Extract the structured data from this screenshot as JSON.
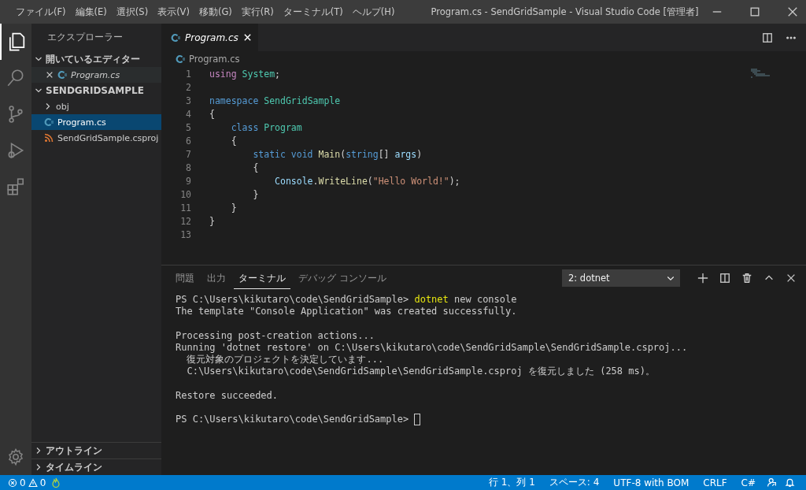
{
  "window": {
    "title": "Program.cs - SendGridSample - Visual Studio Code [管理者]"
  },
  "menu": [
    "ファイル(F)",
    "編集(E)",
    "選択(S)",
    "表示(V)",
    "移動(G)",
    "実行(R)",
    "ターミナル(T)",
    "ヘルプ(H)"
  ],
  "activity_bar": [
    {
      "kind": "explorer",
      "selected": true
    },
    {
      "kind": "search",
      "selected": false
    },
    {
      "kind": "scm",
      "selected": false
    },
    {
      "kind": "debug",
      "selected": false
    },
    {
      "kind": "extensions",
      "selected": false
    }
  ],
  "sidebar": {
    "title": "エクスプローラー",
    "open_editors": {
      "label": "開いているエディター",
      "expanded": true,
      "items": [
        {
          "name": "Program.cs",
          "kind": "csharp",
          "selected": false
        }
      ]
    },
    "folder": {
      "label": "SENDGRIDSAMPLE",
      "expanded": true,
      "items": [
        {
          "name": "obj",
          "kind": "folder",
          "selected": false
        },
        {
          "name": "Program.cs",
          "kind": "csharp",
          "selected": true
        },
        {
          "name": "SendGridSample.csproj",
          "kind": "rss",
          "selected": false
        }
      ]
    },
    "bottom_sections": [
      {
        "label": "アウトライン",
        "expanded": false
      },
      {
        "label": "タイムライン",
        "expanded": false
      }
    ]
  },
  "editor": {
    "tabs": [
      {
        "label": "Program.cs",
        "selected": true
      }
    ],
    "breadcrumb": "Program.cs",
    "lines": [
      {
        "number": "1",
        "tokens": [
          {
            "text": "using ",
            "kind": "control"
          },
          {
            "text": "System",
            "kind": "type"
          },
          {
            "text": ";",
            "kind": "plain"
          }
        ]
      },
      {
        "number": "2"
      },
      {
        "number": "3",
        "tokens": [
          {
            "text": "namespace ",
            "kind": "keyword"
          },
          {
            "text": "SendGridSample",
            "kind": "type"
          }
        ]
      },
      {
        "number": "4",
        "tokens": [
          {
            "text": "{",
            "kind": "plain"
          }
        ]
      },
      {
        "number": "5",
        "tokens": [
          {
            "text": "    class ",
            "kind": "keyword"
          },
          {
            "text": "Program",
            "kind": "type"
          }
        ]
      },
      {
        "number": "6",
        "tokens": [
          {
            "text": "    {",
            "kind": "plain"
          }
        ]
      },
      {
        "number": "7",
        "tokens": [
          {
            "text": "        static void ",
            "kind": "keyword"
          },
          {
            "text": "Main",
            "kind": "method"
          },
          {
            "text": "(",
            "kind": "plain"
          },
          {
            "text": "string",
            "kind": "keyword"
          },
          {
            "text": "[] ",
            "kind": "plain"
          },
          {
            "text": "args",
            "kind": "variable"
          },
          {
            "text": ")",
            "kind": "plain"
          }
        ]
      },
      {
        "number": "8",
        "tokens": [
          {
            "text": "        {",
            "kind": "plain"
          }
        ]
      },
      {
        "number": "9",
        "tokens": [
          {
            "text": "            Console",
            "kind": "variable"
          },
          {
            "text": ".",
            "kind": "plain"
          },
          {
            "text": "WriteLine",
            "kind": "method"
          },
          {
            "text": "(",
            "kind": "plain"
          },
          {
            "text": "\"Hello World!\"",
            "kind": "string"
          },
          {
            "text": ");",
            "kind": "plain"
          }
        ]
      },
      {
        "number": "10",
        "tokens": [
          {
            "text": "        }",
            "kind": "plain"
          }
        ]
      },
      {
        "number": "11",
        "tokens": [
          {
            "text": "    }",
            "kind": "plain"
          }
        ]
      },
      {
        "number": "12",
        "tokens": [
          {
            "text": "}",
            "kind": "plain"
          }
        ]
      },
      {
        "number": "13"
      }
    ]
  },
  "panel": {
    "tabs": [
      {
        "label": "問題",
        "selected": false
      },
      {
        "label": "出力",
        "selected": false
      },
      {
        "label": "ターミナル",
        "selected": true
      },
      {
        "label": "デバッグ コンソール",
        "selected": false
      }
    ],
    "terminal_select": "2: dotnet",
    "lines": [
      {
        "gap_before": false,
        "segments": [
          {
            "text": "PS C:\\Users\\kikutaro\\code\\SendGridSample> ",
            "kind": "plain"
          },
          {
            "text": "dotnet",
            "kind": "command"
          },
          {
            "text": " new console",
            "kind": "plain"
          }
        ]
      },
      {
        "gap_before": false,
        "segments": [
          {
            "text": "The template \"Console Application\" was created successfully.",
            "kind": "plain"
          }
        ]
      },
      {
        "gap_before": true,
        "segments": [
          {
            "text": "Processing post-creation actions...",
            "kind": "plain"
          }
        ]
      },
      {
        "gap_before": false,
        "segments": [
          {
            "text": "Running 'dotnet restore' on C:\\Users\\kikutaro\\code\\SendGridSample\\SendGridSample.csproj...",
            "kind": "plain"
          }
        ]
      },
      {
        "gap_before": false,
        "segments": [
          {
            "text": "  復元対象のプロジェクトを決定しています...",
            "kind": "plain"
          }
        ]
      },
      {
        "gap_before": false,
        "segments": [
          {
            "text": "  C:\\Users\\kikutaro\\code\\SendGridSample\\SendGridSample.csproj を復元しました (258 ms)。",
            "kind": "plain"
          }
        ]
      },
      {
        "gap_before": true,
        "segments": [
          {
            "text": "Restore succeeded.",
            "kind": "plain"
          }
        ]
      },
      {
        "gap_before": true,
        "segments": [
          {
            "text": "PS C:\\Users\\kikutaro\\code\\SendGridSample> ",
            "kind": "plain"
          }
        ],
        "cursor": true
      }
    ]
  },
  "status_bar": {
    "errors": "0",
    "warnings": "0",
    "right": [
      {
        "text": "行 1、列 1",
        "kind": "text"
      },
      {
        "text": "スペース: 4",
        "kind": "text"
      },
      {
        "text": "UTF-8 with BOM",
        "kind": "text"
      },
      {
        "text": "CRLF",
        "kind": "text"
      },
      {
        "text": "C#",
        "kind": "text"
      },
      {
        "kind": "feedback"
      },
      {
        "kind": "bell"
      }
    ]
  }
}
